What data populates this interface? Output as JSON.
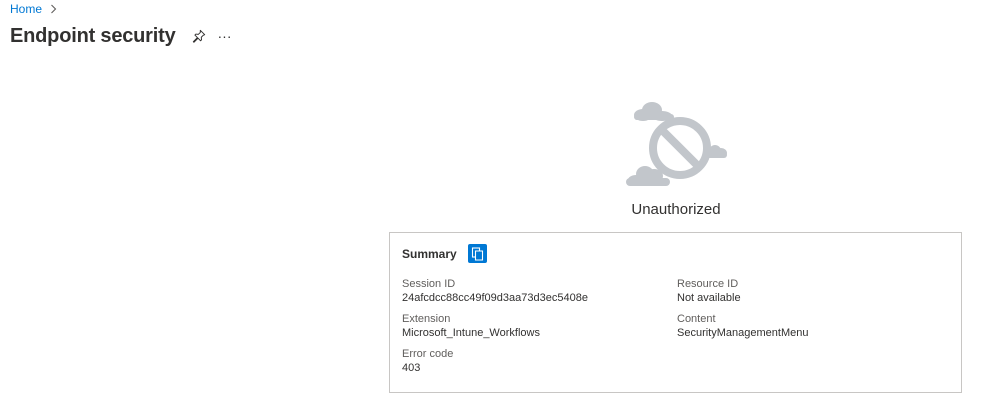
{
  "breadcrumb": {
    "home_label": "Home",
    "separator_icon": "chevron-right-icon"
  },
  "header": {
    "title": "Endpoint security",
    "pin_icon": "pin-icon",
    "more_label": "···"
  },
  "status": {
    "icon": "unauthorized-cloud-icon",
    "text": "Unauthorized"
  },
  "summary": {
    "title": "Summary",
    "copy_icon": "copy-icon",
    "session_id_label": "Session ID",
    "session_id_value": "24afcdcc88cc49f09d3aa73d3ec5408e",
    "resource_id_label": "Resource ID",
    "resource_id_value": "Not available",
    "extension_label": "Extension",
    "extension_value": "Microsoft_Intune_Workflows",
    "content_label": "Content",
    "content_value": "SecurityManagementMenu",
    "error_code_label": "Error code",
    "error_code_value": "403"
  },
  "colors": {
    "link": "#0078d4",
    "accent": "#0078d4",
    "illustration": "#c2c6cb",
    "border": "#c8c6c4"
  }
}
